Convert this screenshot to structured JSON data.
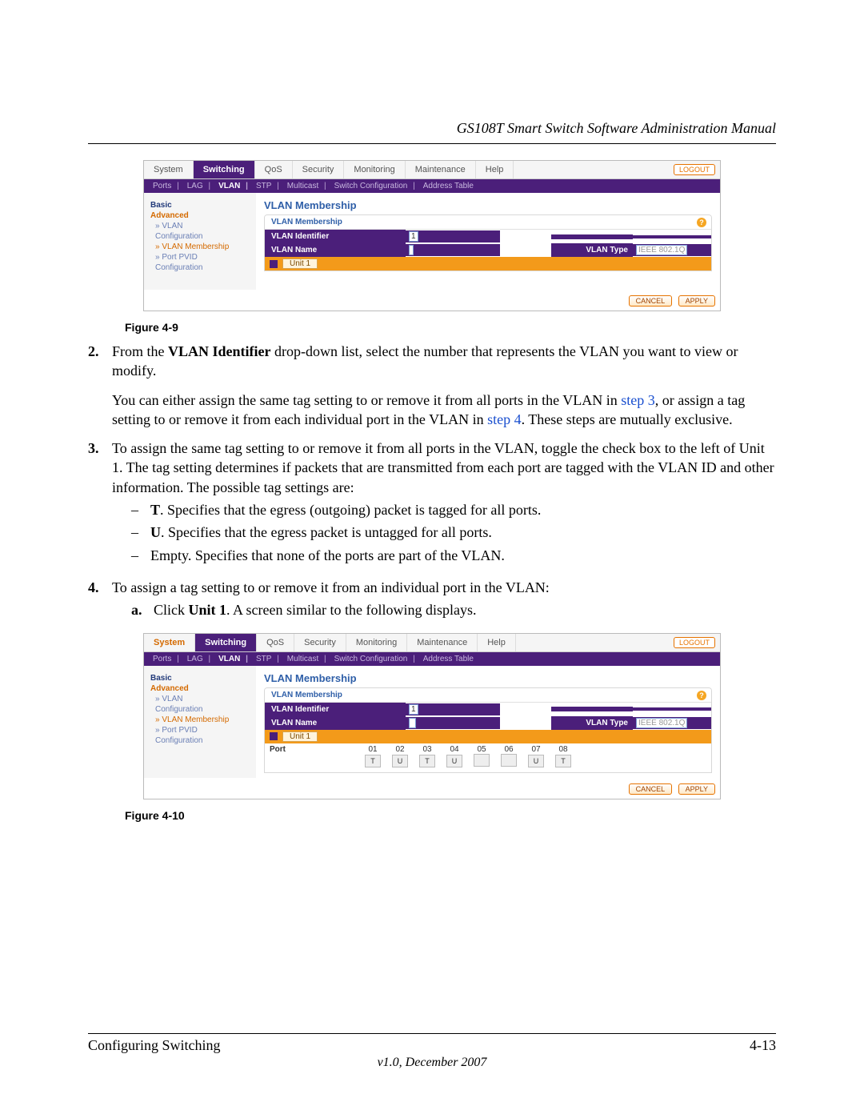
{
  "header_title": "GS108T Smart Switch Software Administration Manual",
  "fig1": {
    "caption": "Figure 4-9",
    "tabs": [
      "System",
      "Switching",
      "QoS",
      "Security",
      "Monitoring",
      "Maintenance",
      "Help"
    ],
    "logout": "LOGOUT",
    "subtabs": [
      "Ports",
      "LAG",
      "VLAN",
      "STP",
      "Multicast",
      "Switch Configuration",
      "Address Table"
    ],
    "sidebar": {
      "basic": "Basic",
      "advanced": "Advanced",
      "items": [
        "VLAN",
        "Configuration",
        "VLAN Membership",
        "Port PVID",
        "Configuration"
      ]
    },
    "main_title": "VLAN Membership",
    "box_title": "VLAN Membership",
    "row_id_label": "VLAN Identifier",
    "row_id_value": "1",
    "row_name_label": "VLAN Name",
    "row_name_value": "",
    "row_type_label": "VLAN Type",
    "row_type_value": "IEEE 802.1Q",
    "unit_label": "Unit 1",
    "cancel": "CANCEL",
    "apply": "APPLY"
  },
  "step2": {
    "num": "2.",
    "text_a": "From the ",
    "bold": "VLAN Identifier",
    "text_b": " drop-down list, select the number that represents the VLAN you want to view or modify."
  },
  "para2": {
    "a": "You can either assign the same tag setting to or remove it from all ports in the VLAN in ",
    "link1": "step 3",
    "b": ", or assign a tag setting to or remove it from each individual port in the VLAN in ",
    "link2": "step 4",
    "c": ". These steps are mutually exclusive."
  },
  "step3": {
    "num": "3.",
    "text": "To assign the same tag setting to or remove it from all ports in the VLAN, toggle the check box to the left of Unit 1. The tag setting determines if packets that are transmitted from each port are tagged with the VLAN ID and other information. The possible tag settings are:",
    "bullets": [
      {
        "b": "T",
        "t": ". Specifies that the egress (outgoing) packet is tagged for all ports."
      },
      {
        "b": "U",
        "t": ". Specifies that the egress packet is untagged for all ports."
      },
      {
        "b": "",
        "t": "Empty. Specifies that none of the ports are part of the VLAN."
      }
    ]
  },
  "step4": {
    "num": "4.",
    "text": "To assign a tag setting to or remove it from an individual port in the VLAN:",
    "a_lbl": "a.",
    "a_pre": "Click ",
    "a_bold": "Unit 1",
    "a_post": ". A screen similar to the following displays."
  },
  "fig2": {
    "caption": "Figure 4-10",
    "port_label": "Port",
    "ports": [
      "01",
      "02",
      "03",
      "04",
      "05",
      "06",
      "07",
      "08"
    ],
    "states": [
      "T",
      "U",
      "T",
      "U",
      "",
      "",
      "U",
      "T"
    ]
  },
  "footer": {
    "left": "Configuring Switching",
    "right": "4-13",
    "ver": "v1.0, December 2007"
  }
}
